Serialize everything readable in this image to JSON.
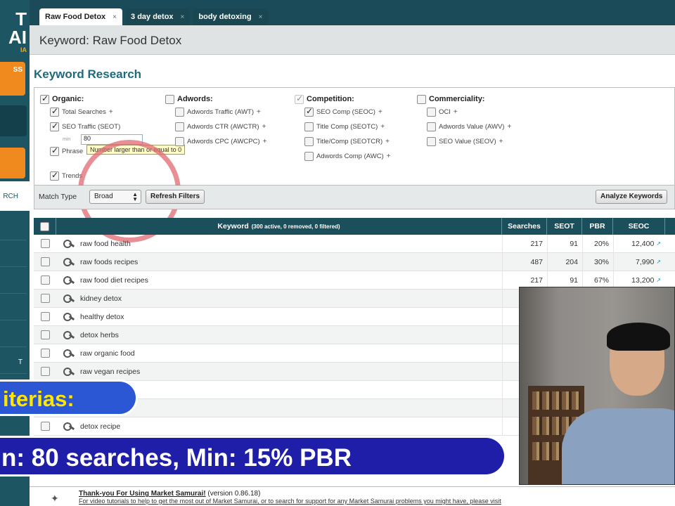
{
  "sidebar": {
    "logo_text": "T",
    "logo_line2": "AI",
    "logo_sub": "IA",
    "orange_item_text": "SS",
    "research_label": "RCH",
    "item_text_t": "T"
  },
  "tabs": [
    {
      "label": "Raw Food Detox",
      "close": "×"
    },
    {
      "label": "3 day detox",
      "close": "×"
    },
    {
      "label": "body detoxing",
      "close": "×"
    }
  ],
  "keyword_header": "Keyword: Raw Food Detox",
  "section_title": "Keyword Research",
  "filters": {
    "organic": {
      "label": "Organic:",
      "items": [
        "Total Searches",
        "SEO Traffic (SEOT)",
        "Phrase",
        "Trends"
      ],
      "min_value": "80",
      "min_label": "min",
      "tooltip": "Number larger than or equal to 0"
    },
    "adwords": {
      "label": "Adwords:",
      "items": [
        "Adwords Traffic (AWT)",
        "Adwords CTR (AWCTR)",
        "Adwords CPC (AWCPC)"
      ]
    },
    "competition": {
      "label": "Competition:",
      "items": [
        "SEO Comp (SEOC)",
        "Title Comp (SEOTC)",
        "Title/Comp (SEOTCR)",
        "Adwords Comp (AWC)"
      ]
    },
    "commerciality": {
      "label": "Commerciality:",
      "items": [
        "OCI",
        "Adwords Value (AWV)",
        "SEO Value (SEOV)"
      ]
    },
    "plus_icon": "+"
  },
  "match": {
    "label": "Match Type",
    "value": "Broad",
    "refresh_button": "Refresh Filters",
    "analyze_button": "Analyze Keywords"
  },
  "table": {
    "headers": {
      "keyword": "Keyword",
      "keyword_meta": "(300 active, 0 removed, 0 filtered)",
      "searches": "Searches",
      "seot": "SEOT",
      "pbr": "PBR",
      "seoc": "SEOC"
    },
    "rows": [
      {
        "keyword": "raw food health",
        "searches": "217",
        "seot": "91",
        "pbr": "20%",
        "seoc": "12,400"
      },
      {
        "keyword": "raw foods recipes",
        "searches": "487",
        "seot": "204",
        "pbr": "30%",
        "seoc": "7,990"
      },
      {
        "keyword": "raw food diet recipes",
        "searches": "217",
        "seot": "91",
        "pbr": "67%",
        "seoc": "13,200"
      },
      {
        "keyword": "kidney detox",
        "searches": "",
        "seot": "",
        "pbr": "",
        "seoc": ""
      },
      {
        "keyword": "healthy detox",
        "searches": "",
        "seot": "",
        "pbr": "",
        "seoc": ""
      },
      {
        "keyword": "detox herbs",
        "searches": "",
        "seot": "",
        "pbr": "",
        "seoc": ""
      },
      {
        "keyword": "raw organic food",
        "searches": "",
        "seot": "",
        "pbr": "",
        "seoc": ""
      },
      {
        "keyword": "raw vegan recipes",
        "searches": "",
        "seot": "",
        "pbr": "",
        "seoc": ""
      },
      {
        "keyword": "",
        "searches": "",
        "seot": "",
        "pbr": "",
        "seoc": ""
      },
      {
        "keyword": "",
        "searches": "",
        "seot": "",
        "pbr": "",
        "seoc": ""
      },
      {
        "keyword": "detox recipe",
        "searches": "",
        "seot": "",
        "pbr": "",
        "seoc": ""
      }
    ]
  },
  "footer": {
    "thank_you": "Thank-you For Using Market Samurai!",
    "version": "(version 0.86.18)",
    "help_text": "For video tutorials to help to get the most out of Market Samurai, or to search for support for any Market Samurai problems you might have, please visit"
  },
  "overlays": {
    "criteria": "iterias:",
    "min_line": "n: 80 searches, Min: 15% PBR"
  },
  "colors": {
    "sidebar": "#1d5563",
    "accent_orange": "#f0891e",
    "title_teal": "#1f6a7c",
    "table_header": "#1c4f5c",
    "banner_blue": "#2b56d4",
    "banner_navy": "#1e1ea9",
    "banner_yellow": "#ffe600"
  }
}
